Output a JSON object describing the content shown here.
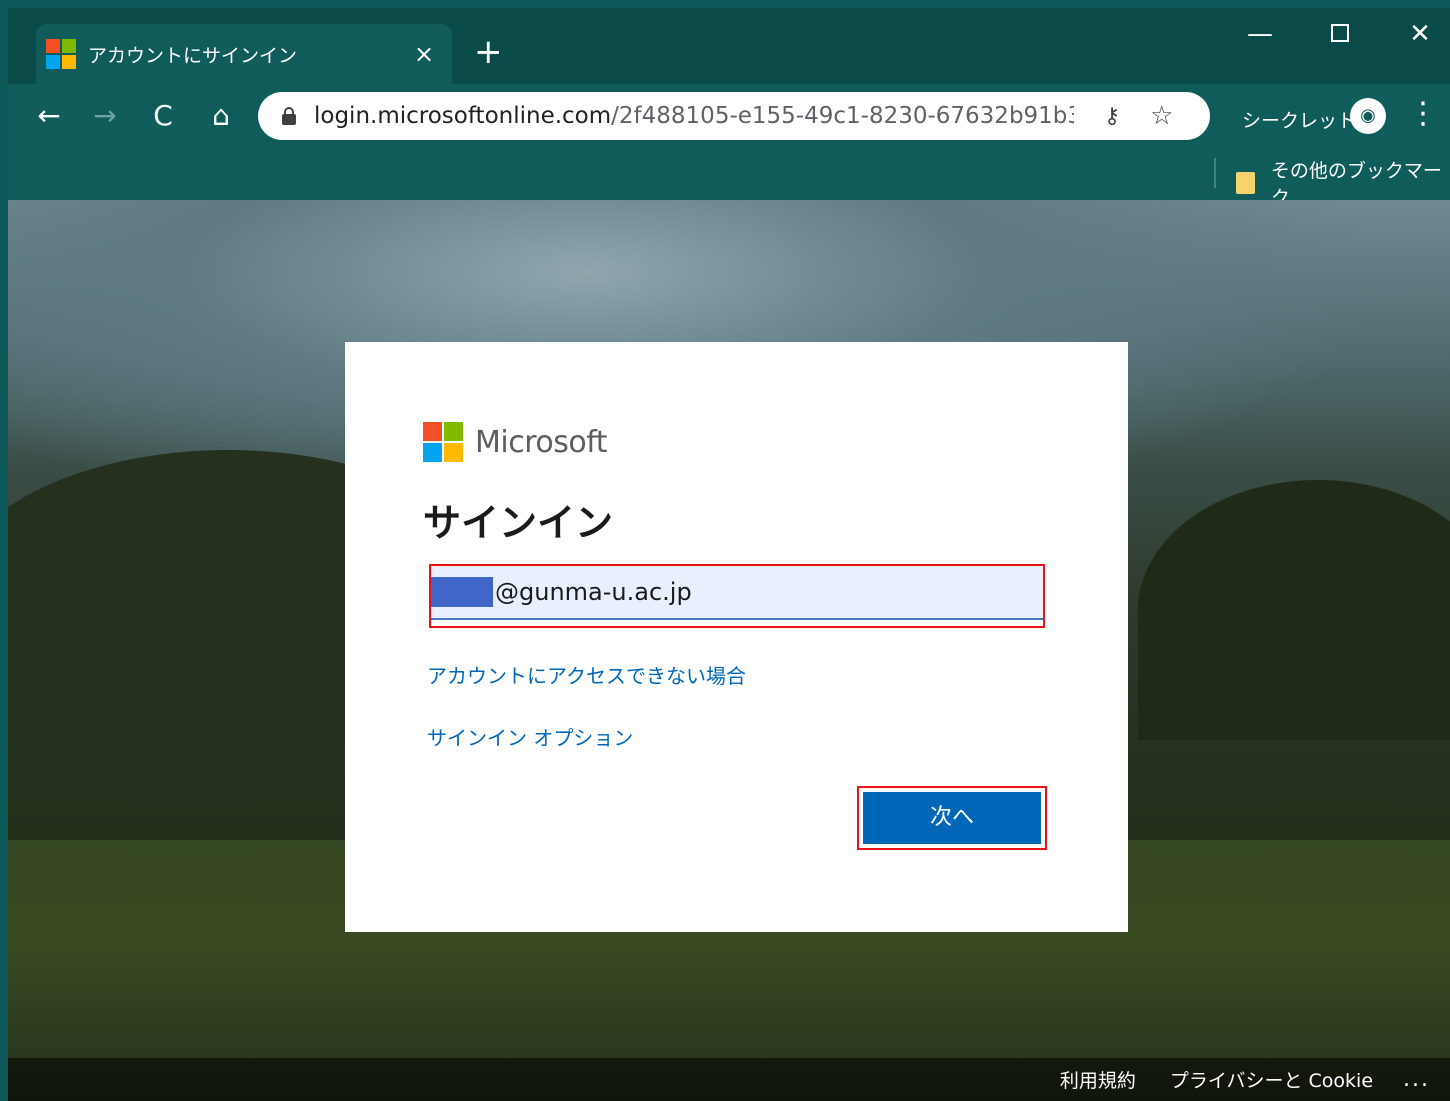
{
  "browser": {
    "tab": {
      "title": "アカウントにサインイン",
      "close": "×"
    },
    "new_tab": "+",
    "window": {
      "minimize": "—",
      "close": "✕"
    },
    "nav": {
      "back": "←",
      "forward": "→",
      "reload": "C",
      "home": "⌂"
    },
    "url": {
      "host": "login.microsoftonline.com",
      "path": "/2f488105-e155-49c1-8230-67632b91b3..."
    },
    "key_icon": "key-icon",
    "star_icon": "star-icon",
    "incognito": {
      "label": "シークレット",
      "icon": "incognito-icon"
    },
    "menu": "⋮",
    "bookmarks": {
      "other_label": "その他のブックマーク"
    }
  },
  "colors": {
    "ms_red": "#f25022",
    "ms_green": "#7fba00",
    "ms_blue": "#00a4ef",
    "ms_yellow": "#ffb900",
    "primary_button": "#0067b8",
    "highlight_outline": "#e8121b"
  },
  "signin": {
    "brand": "Microsoft",
    "title": "サインイン",
    "email_value": "@gunma-u.ac.jp",
    "cant_access_link": "アカウントにアクセスできない場合",
    "signin_options_link": "サインイン オプション",
    "next_button": "次へ"
  },
  "footer": {
    "terms": "利用規約",
    "privacy": "プライバシーと Cookie",
    "more": "..."
  }
}
